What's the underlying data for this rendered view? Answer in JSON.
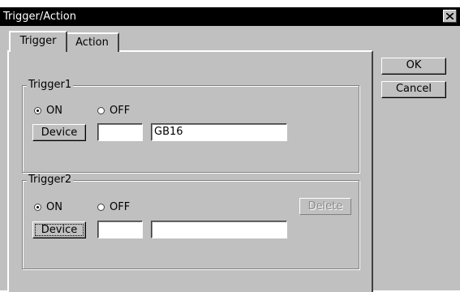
{
  "window": {
    "title": "Trigger/Action",
    "close_glyph": "close-icon"
  },
  "tabs": [
    {
      "label": "Trigger",
      "active": true
    },
    {
      "label": "Action",
      "active": false
    }
  ],
  "buttons": {
    "ok": "OK",
    "cancel": "Cancel"
  },
  "trigger1": {
    "label": "Trigger1",
    "on_label": "ON",
    "off_label": "OFF",
    "selected": "ON",
    "device_button": "Device",
    "device_no": "",
    "device_name": "GB16"
  },
  "trigger2": {
    "label": "Trigger2",
    "on_label": "ON",
    "off_label": "OFF",
    "selected": "ON",
    "device_button": "Device",
    "delete_button": "Delete",
    "delete_enabled": false,
    "device_no": "",
    "device_name": ""
  }
}
